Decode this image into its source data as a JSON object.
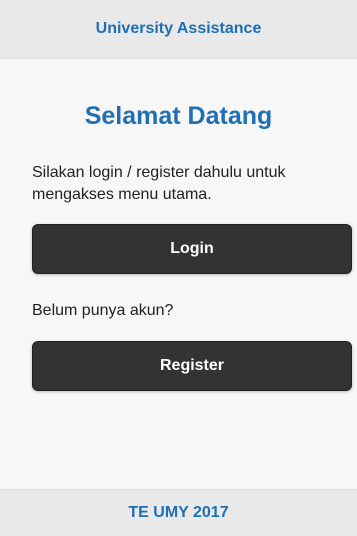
{
  "header": {
    "title": "University Assistance"
  },
  "main": {
    "welcome": "Selamat Datang",
    "intro": "Silakan login / register dahulu untuk mengakses menu utama.",
    "login_label": "Login",
    "no_account_text": "Belum punya akun?",
    "register_label": "Register"
  },
  "footer": {
    "text": "TE UMY 2017"
  },
  "colors": {
    "accent": "#1f6fb2",
    "button_bg": "#333333",
    "bar_bg": "#e9e9e9",
    "page_bg": "#f7f7f7"
  }
}
